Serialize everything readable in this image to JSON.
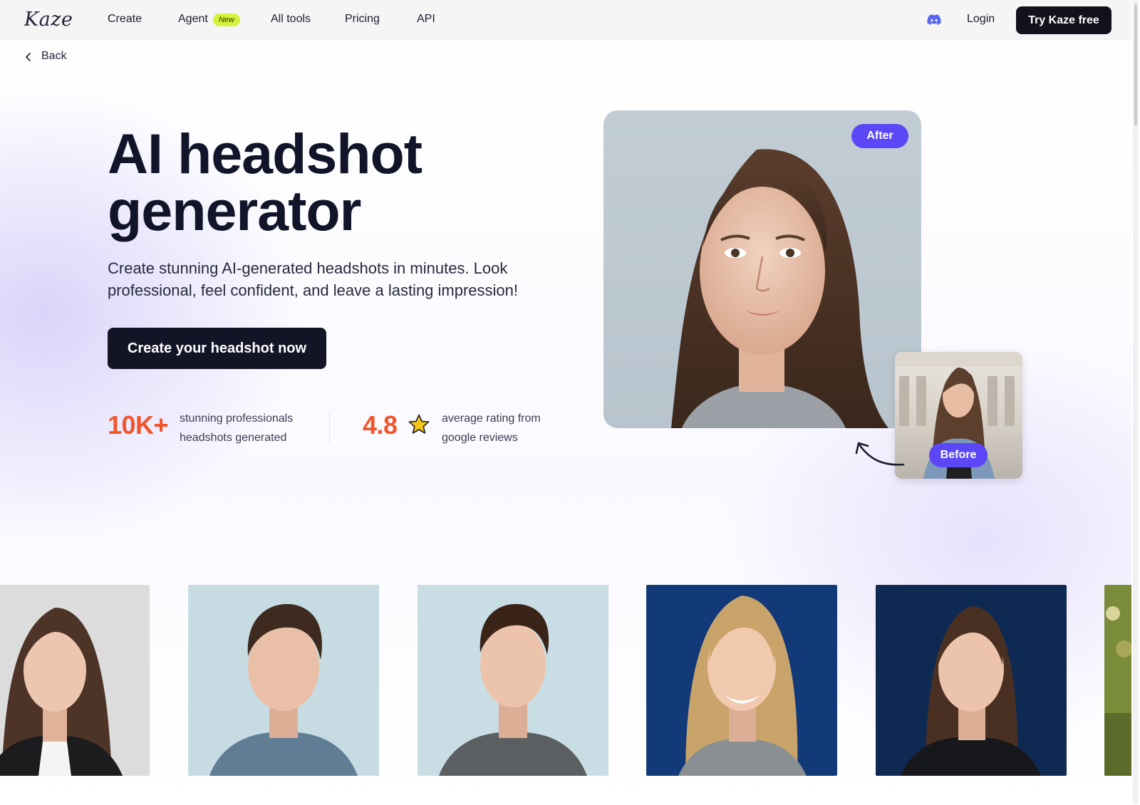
{
  "nav": {
    "logo": "Kaze",
    "items": [
      "Create",
      "Agent",
      "All tools",
      "Pricing",
      "API"
    ],
    "new_badge": "New",
    "login": "Login",
    "try_button": "Try Kaze free",
    "discord_icon": "discord-icon"
  },
  "back_label": "Back",
  "hero": {
    "title_line1": "AI headshot",
    "title_line2": "generator",
    "subtitle": "Create stunning AI-generated headshots in minutes. Look professional, feel confident, and leave a lasting impression!",
    "cta": "Create your headshot now"
  },
  "stats": [
    {
      "value": "10K+",
      "text_line1": "stunning professionals",
      "text_line2": "headshots generated"
    },
    {
      "value": "4.8",
      "text_line1": "average rating from",
      "text_line2": "google reviews"
    }
  ],
  "comparison": {
    "after_label": "After",
    "before_label": "Before"
  },
  "colors": {
    "accent": "#5b47f5",
    "stat_orange": "#f2552c",
    "cta_dark": "#131526",
    "new_badge": "#d6f33c",
    "star": "#f5c518"
  },
  "gallery": [
    {
      "name": "woman-brunette-black-blazer",
      "bg": "#dcdcdc"
    },
    {
      "name": "man-blue-tshirt",
      "bg": "#c7dbe3"
    },
    {
      "name": "man-grey-tshirt",
      "bg": "#c9dde5"
    },
    {
      "name": "woman-blonde-blue-background",
      "bg": "#123a78"
    },
    {
      "name": "woman-brunette-navy-background",
      "bg": "#0f2a52"
    },
    {
      "name": "person-outdoor-partial",
      "bg": "#7a8b3a"
    }
  ]
}
